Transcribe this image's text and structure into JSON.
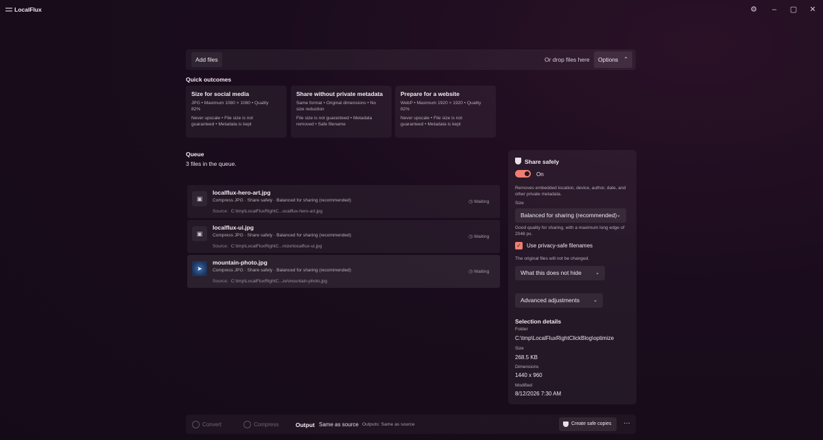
{
  "app": {
    "title": "LocalFlux"
  },
  "window": {
    "settings_icon": "gear-icon",
    "minimize_glyph": "–",
    "restore_glyph": "▢",
    "close_glyph": "✕"
  },
  "toolbar": {
    "add_files_label": "Add files",
    "drop_text": "Or drop files here",
    "options_label": "Options"
  },
  "quick_outcomes": {
    "title": "Quick outcomes",
    "cards": [
      {
        "title": "Size for social media",
        "line1": "JPG • Maximum 1080 × 1080 • Quality",
        "line2": "82%",
        "line3": "Never upscale • File size is not",
        "line4": "guaranteed • Metadata is kept"
      },
      {
        "title": "Share without private metadata",
        "line1": "Same format • Original dimensions • No",
        "line2": "size reduction",
        "line3": "File size is not guaranteed • Metadata",
        "line4": "removed • Safe filename"
      },
      {
        "title": "Prepare for a website",
        "line1": "WebP • Maximum 1920 × 1920 • Quality",
        "line2": "82%",
        "line3": "Never upscale • File size is not",
        "line4": "guaranteed • Metadata is kept"
      }
    ]
  },
  "queue": {
    "title": "Queue",
    "count_text": "3 files in the queue.",
    "source_label": "Source:",
    "items": [
      {
        "name": "localflux-hero-art.jpg",
        "desc": "Compress JPG · Share safely · Balanced for sharing (recommended)",
        "source": "C:\\tmp\\LocalFluxRightC...ocalflux-hero-art.jpg",
        "status": "Waiting"
      },
      {
        "name": "localflux-ui.jpg",
        "desc": "Compress JPG · Share safely · Balanced for sharing (recommended)",
        "source": "C:\\tmp\\LocalFluxRightC...mize\\localflux-ui.jpg",
        "status": "Waiting"
      },
      {
        "name": "mountain-photo.jpg",
        "desc": "Compress JPG · Share safely · Balanced for sharing (recommended)",
        "source": "C:\\tmp\\LocalFluxRightC...ze\\mountain-photo.jpg",
        "status": "Waiting"
      }
    ]
  },
  "sidebar": {
    "title": "Share safely",
    "toggle_label": "On",
    "toggle_on": true,
    "description": "Removes embedded location, device, author, date, and other private metadata.",
    "size_label": "Size",
    "size_value": "Balanced for sharing (recommended)",
    "size_help": "Good quality for sharing, with a maximum long edge of 2048 px.",
    "privacy_filenames_label": "Use privacy-safe filenames",
    "privacy_filenames_checked": true,
    "original_note": "The original files will not be changed.",
    "what_not_hide_label": "What this does not hide",
    "advanced_label": "Advanced adjustments",
    "selection": {
      "title": "Selection details",
      "folder_label": "Folder",
      "folder_value": "C:\\tmp\\LocalFluxRightClickBlog\\optimize",
      "size_label": "Size",
      "size_value": "268.5 KB",
      "dimensions_label": "Dimensions",
      "dimensions_value": "1440 x 960",
      "modified_label": "Modified",
      "modified_value": "8/12/2026 7:30 AM"
    }
  },
  "bottombar": {
    "convert_label": "Convert",
    "compress_label": "Compress",
    "output_label": "Output",
    "output_value": "Same as source",
    "outputs_text": "Outputs: Same as source",
    "create_label": "Create safe copies",
    "more_glyph": "···"
  },
  "colors": {
    "accent": "#ee7f72",
    "background": "#1a0c1c",
    "selected_icon": "#3a6fb6"
  }
}
